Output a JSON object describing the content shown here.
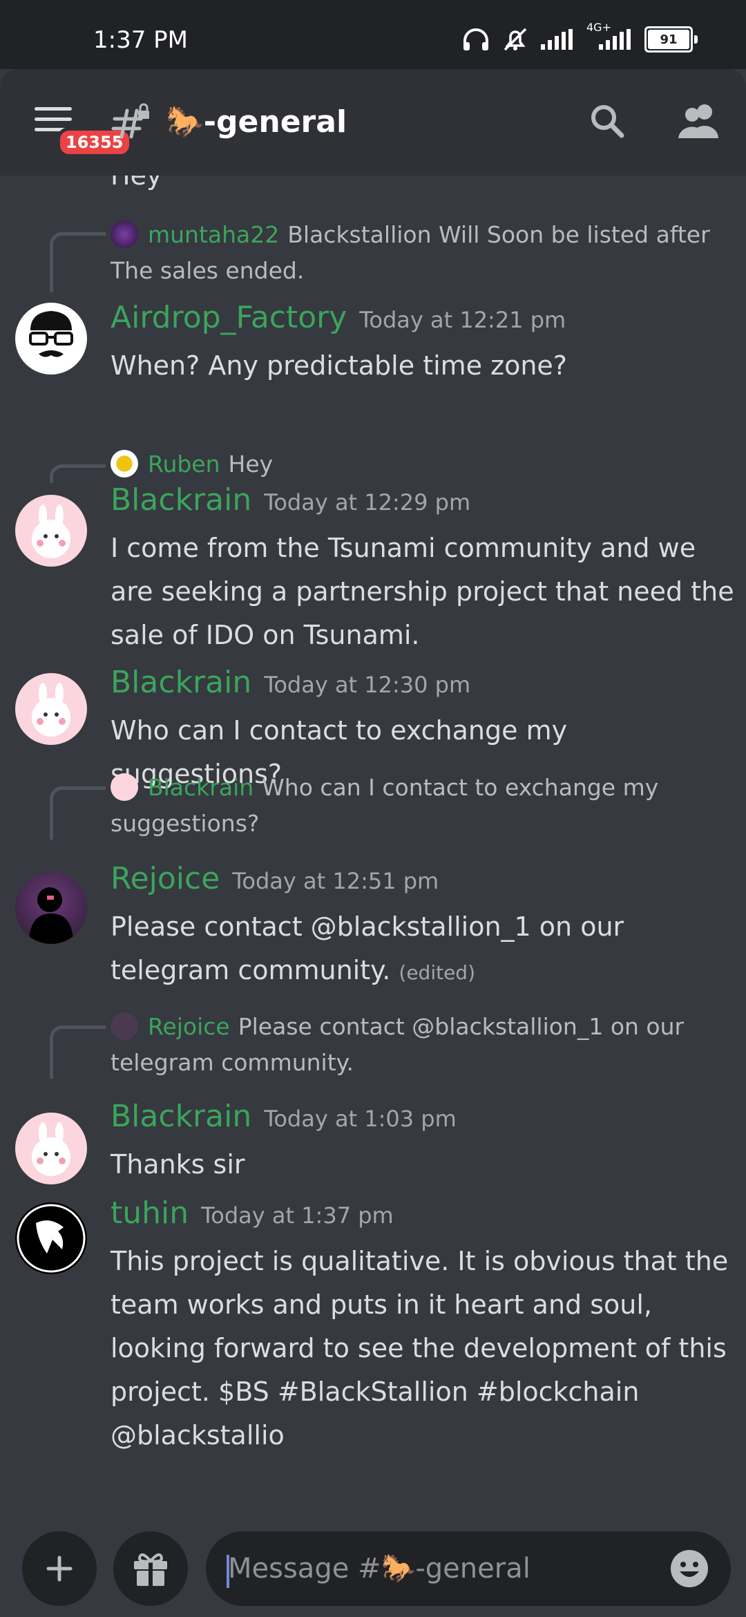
{
  "status_bar": {
    "time": "1:37 PM",
    "network": "4G+",
    "battery": "91"
  },
  "header": {
    "unread_badge": "16355",
    "channel_name": "🐎-general"
  },
  "partial_top_text": "Hey",
  "messages": [
    {
      "reply": {
        "author": "muntaha22",
        "text": "Blackstallion Will Soon be listed after The sales ended."
      },
      "author": "Airdrop_Factory",
      "timestamp": "Today at 12:21 pm",
      "body": "When? Any predictable time zone?"
    },
    {
      "reply": {
        "author": "Ruben",
        "text": "Hey"
      },
      "author": "Blackrain",
      "timestamp": "Today at 12:29 pm",
      "body": "I come from the Tsunami community and we are seeking a partnership project that need the sale of IDO on Tsunami."
    },
    {
      "author": "Blackrain",
      "timestamp": "Today at 12:30 pm",
      "body": "Who can I contact to exchange my suggestions?"
    },
    {
      "reply": {
        "author": "Blackrain",
        "text": "Who can I contact to exchange my suggestions?"
      },
      "author": "Rejoice",
      "timestamp": "Today at 12:51 pm",
      "body": "Please contact @blackstallion_1 on our telegram community.",
      "edited": "(edited)"
    },
    {
      "reply": {
        "author": "Rejoice",
        "text": "Please contact @blackstallion_1 on our telegram community."
      },
      "author": "Blackrain",
      "timestamp": "Today at 1:03 pm",
      "body": "Thanks sir"
    },
    {
      "author": "tuhin",
      "timestamp": "Today at 1:37 pm",
      "body": "This project is qualitative. It is obvious that the team works and puts in it heart and soul, looking forward to see the development of this project. $BS #BlackStallion #blockchain @blackstallio"
    }
  ],
  "composer": {
    "placeholder": "Message #🐎-general"
  },
  "colors": {
    "background": "#36393f",
    "header": "#2f3136",
    "username": "#3ba55c",
    "badge": "#ed4245"
  }
}
